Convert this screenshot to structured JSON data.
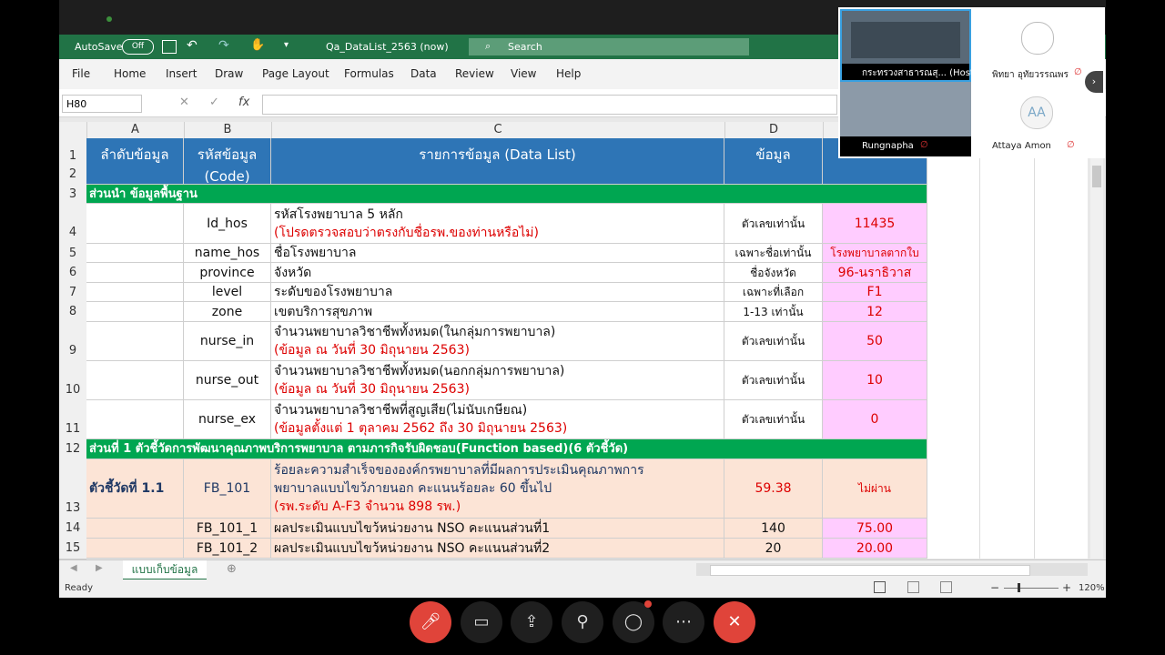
{
  "titlebar": {
    "autosave_label": "AutoSave",
    "autosave_state": "Off",
    "filename": "Qa_DataList_2563 (now)",
    "search_placeholder": "Search"
  },
  "menu": [
    "File",
    "Home",
    "Insert",
    "Draw",
    "Page Layout",
    "Formulas",
    "Data",
    "Review",
    "View",
    "Help"
  ],
  "formula": {
    "namebox": "H80",
    "fx": "fx"
  },
  "columns": [
    "A",
    "B",
    "C",
    "D"
  ],
  "rows": {
    "r1": {
      "num": "1",
      "a": "ลำดับข้อมูล",
      "b": "รหัสข้อมูล",
      "c": "รายการข้อมูล (Data List)",
      "d": "ข้อมูล"
    },
    "r2": {
      "num": "2",
      "b": "(Code)"
    },
    "r3": {
      "num": "3",
      "text": "ส่วนนำ ข้อมูลพื้นฐาน"
    },
    "r4": {
      "num": "4",
      "b": "Id_hos",
      "c1": "รหัสโรงพยาบาล 5 หลัก",
      "c2": "(โปรดตรวจสอบว่าตรงกับชื่อรพ.ของท่านหรือไม่)",
      "d": "ตัวเลขเท่านั้น",
      "e": "11435"
    },
    "r5": {
      "num": "5",
      "b": "name_hos",
      "c": "ชื่อโรงพยาบาล",
      "d": "เฉพาะชื่อเท่านั้น",
      "e": "โรงพยาบาลตากใบ"
    },
    "r6": {
      "num": "6",
      "b": "province",
      "c": "จังหวัด",
      "d": "ชื่อจังหวัด",
      "e": "96-นราธิวาส"
    },
    "r7": {
      "num": "7",
      "b": "level",
      "c": "ระดับของโรงพยาบาล",
      "d": "เฉพาะที่เลือก",
      "e": "F1"
    },
    "r8": {
      "num": "8",
      "b": "zone",
      "c": "เขตบริการสุขภาพ",
      "d": "1-13 เท่านั้น",
      "e": "12"
    },
    "r9": {
      "num": "9",
      "b": "nurse_in",
      "c1": "จำนวนพยาบาลวิชาชีพทั้งหมด(ในกลุ่มการพยาบาล)",
      "c2": "(ข้อมูล ณ วันที่ 30 มิถุนายน 2563)",
      "d": "ตัวเลขเท่านั้น",
      "e": "50"
    },
    "r10": {
      "num": "10",
      "b": "nurse_out",
      "c1": "จำนวนพยาบาลวิชาชีพทั้งหมด(นอกกลุ่มการพยาบาล)",
      "c2": "(ข้อมูล ณ วันที่ 30 มิถุนายน 2563)",
      "d": "ตัวเลขเท่านั้น",
      "e": "10"
    },
    "r11": {
      "num": "11",
      "b": "nurse_ex",
      "c1": "จำนวนพยาบาลวิชาชีพที่สูญเสีย(ไม่นับเกษียณ)",
      "c2": "(ข้อมูลตั้งแต่ 1 ตุลาคม 2562 ถึง 30 มิถุนายน 2563)",
      "d": "ตัวเลขเท่านั้น",
      "e": "0"
    },
    "r12": {
      "num": "12",
      "text": "ส่วนที่ 1 ตัวชี้วัดการพัฒนาคุณภาพบริการพยาบาล ตามภารกิจรับผิดชอบ(Function based)(6 ตัวชี้วัด)"
    },
    "r13": {
      "num": "13",
      "a": "ตัวชี้วัดที่ 1.1",
      "b": "FB_101",
      "c1": "ร้อยละความสำเร็จขององค์กรพยาบาลที่มีผลการประเมินคุณภาพการ",
      "c2": "พยาบาลแบบไขว้ภายนอก คะแนนร้อยละ 60 ขึ้นไป",
      "c3": "(รพ.ระดับ A-F3 จำนวน 898 รพ.)",
      "d": "59.38",
      "e": "ไม่ผ่าน"
    },
    "r14": {
      "num": "14",
      "b": "FB_101_1",
      "c": "ผลประเมินแบบไขว้หน่วยงาน NSO คะแนนส่วนที่1",
      "d": "140",
      "e": "75.00"
    },
    "r15": {
      "num": "15",
      "b": "FB_101_2",
      "c": "ผลประเมินแบบไขว้หน่วยงาน NSO คะแนนส่วนที่2",
      "d": "20",
      "e": "20.00"
    }
  },
  "sheet_tab": "แบบเก็บข้อมูล",
  "status": {
    "ready": "Ready",
    "zoom": "120%"
  },
  "participants": [
    {
      "name": "กระทรวงสาธารณสุ... (Host)"
    },
    {
      "name": "พิทยา อุทัยวรรณพร"
    },
    {
      "name": "Rungnapha"
    },
    {
      "name": "Attaya Amon",
      "initials": "AA"
    }
  ],
  "colors": {
    "excel_green": "#217346",
    "header_blue": "#2e75b6",
    "band_green": "#00a651",
    "pink": "#ffccff",
    "peach": "#fce4d6",
    "mic_red": "#e0443a"
  }
}
